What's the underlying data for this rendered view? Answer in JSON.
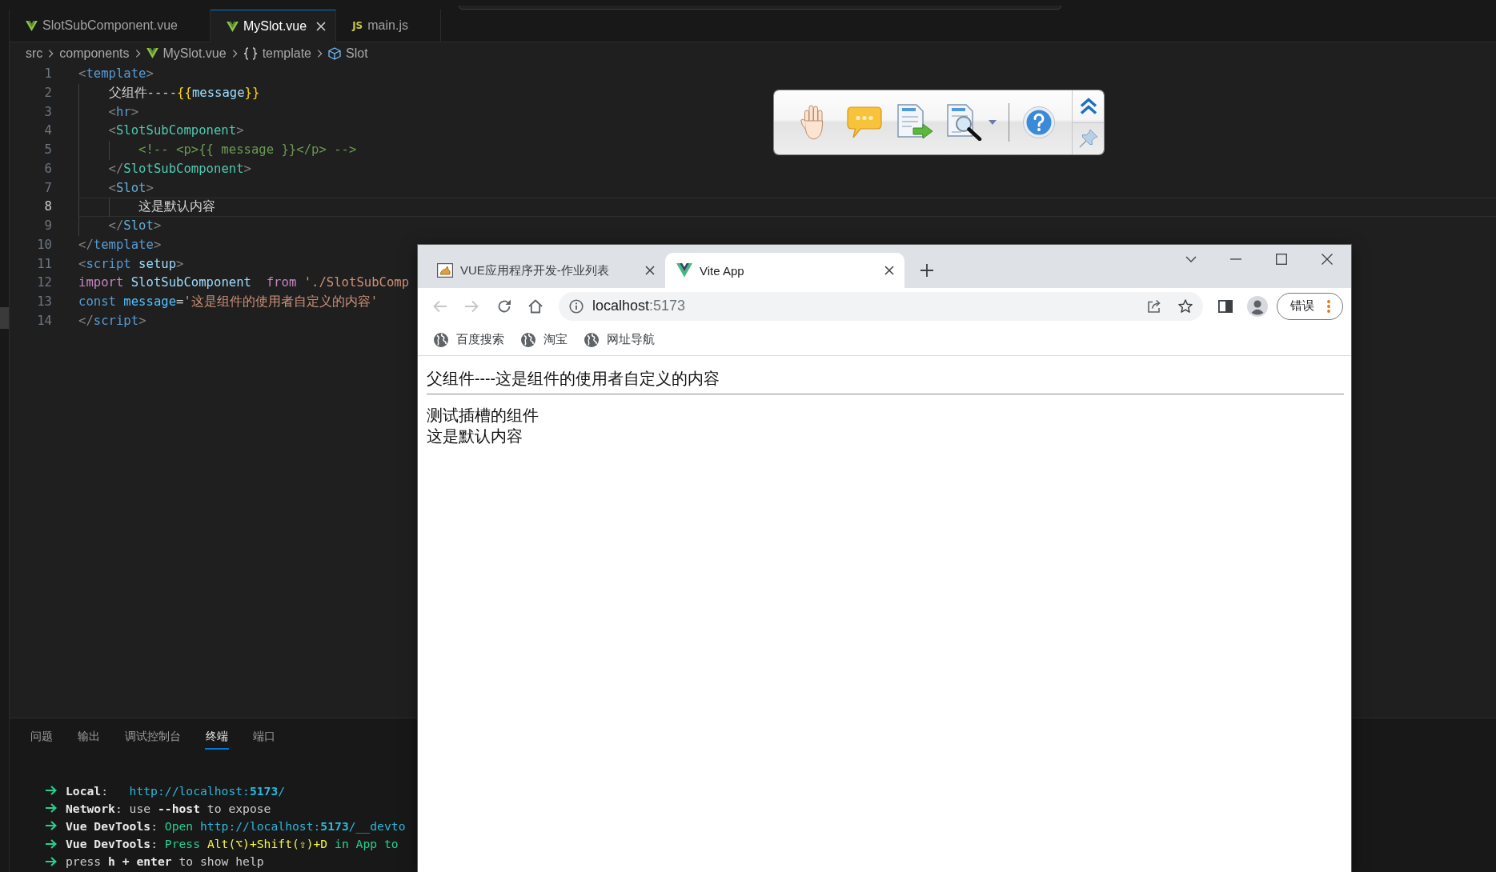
{
  "editor": {
    "tabs": [
      {
        "label": "SlotSubComponent.vue",
        "kind": "vue",
        "selected": false
      },
      {
        "label": "MySlot.vue",
        "kind": "vue",
        "selected": true
      },
      {
        "label": "main.js",
        "kind": "js",
        "badge": "JS",
        "selected": false
      }
    ],
    "breadcrumb": [
      {
        "label": "src",
        "kind": "folder"
      },
      {
        "label": "components",
        "kind": "folder"
      },
      {
        "label": "MySlot.vue",
        "kind": "vue"
      },
      {
        "label": "template",
        "kind": "braces"
      },
      {
        "label": "Slot",
        "kind": "cube"
      }
    ],
    "lines": [
      {
        "number": "1",
        "current": false,
        "tokens": [
          {
            "kind": "bracket",
            "text": "<"
          },
          {
            "kind": "tag",
            "text": "template"
          },
          {
            "kind": "bracket",
            "text": ">"
          }
        ],
        "children": [
          {
            "number": "2",
            "current": false,
            "tokens": [
              {
                "kind": "plain",
                "text": "父组件----"
              },
              {
                "kind": "interp",
                "text": "{{"
              },
              {
                "kind": "variable",
                "text": "message"
              },
              {
                "kind": "interp",
                "text": "}}"
              }
            ]
          },
          {
            "number": "3",
            "current": false,
            "tokens": [
              {
                "kind": "bracket",
                "text": "<"
              },
              {
                "kind": "tag",
                "text": "hr"
              },
              {
                "kind": "bracket",
                "text": ">"
              }
            ]
          },
          {
            "number": "4",
            "current": false,
            "tokens": [
              {
                "kind": "bracket",
                "text": "<"
              },
              {
                "kind": "component",
                "text": "SlotSubComponent"
              },
              {
                "kind": "bracket",
                "text": ">"
              }
            ],
            "children": [
              {
                "number": "5",
                "current": false,
                "tokens": [
                  {
                    "kind": "comment",
                    "text": "<!-- <p>{{ message }}</p> -->"
                  }
                ]
              }
            ]
          },
          {
            "number": "6",
            "current": false,
            "tokens": [
              {
                "kind": "bracket",
                "text": "</"
              },
              {
                "kind": "component",
                "text": "SlotSubComponent"
              },
              {
                "kind": "bracket",
                "text": ">"
              }
            ]
          },
          {
            "number": "7",
            "current": false,
            "tokens": [
              {
                "kind": "bracket",
                "text": "<"
              },
              {
                "kind": "slot",
                "text": "Slot"
              },
              {
                "kind": "bracket",
                "text": ">"
              }
            ],
            "children": [
              {
                "number": "8",
                "current": true,
                "tokens": [
                  {
                    "kind": "plain",
                    "text": "这是默认内容"
                  }
                ]
              }
            ]
          },
          {
            "number": "9",
            "current": false,
            "tokens": [
              {
                "kind": "bracket",
                "text": "</"
              },
              {
                "kind": "slot",
                "text": "Slot"
              },
              {
                "kind": "bracket",
                "text": ">"
              }
            ]
          }
        ]
      },
      {
        "number": "10",
        "current": false,
        "tokens": [
          {
            "kind": "bracket",
            "text": "</"
          },
          {
            "kind": "tag",
            "text": "template"
          },
          {
            "kind": "bracket",
            "text": ">"
          }
        ]
      },
      {
        "number": "11",
        "current": false,
        "tokens": [
          {
            "kind": "bracket",
            "text": "<"
          },
          {
            "kind": "tag",
            "text": "script"
          },
          {
            "kind": "attr",
            "text": " setup"
          },
          {
            "kind": "bracket",
            "text": ">"
          }
        ]
      },
      {
        "number": "12",
        "current": false,
        "tokens": [
          {
            "kind": "keyword",
            "text": "import "
          },
          {
            "kind": "variable",
            "text": "SlotSubComponent  "
          },
          {
            "kind": "keyword",
            "text": "from "
          },
          {
            "kind": "string",
            "text": "'./SlotSubComp"
          }
        ]
      },
      {
        "number": "13",
        "current": false,
        "tokens": [
          {
            "kind": "storage",
            "text": "const "
          },
          {
            "kind": "constant",
            "text": "message"
          },
          {
            "kind": "plain",
            "text": "="
          },
          {
            "kind": "string",
            "text": "'这是组件的使用者自定义的内容'"
          }
        ]
      },
      {
        "number": "14",
        "current": false,
        "tokens": [
          {
            "kind": "bracket",
            "text": "</"
          },
          {
            "kind": "tag",
            "text": "script"
          },
          {
            "kind": "bracket",
            "text": ">"
          }
        ]
      }
    ]
  },
  "panel": {
    "tabs": [
      {
        "label": "问题",
        "selected": false
      },
      {
        "label": "输出",
        "selected": false
      },
      {
        "label": "调试控制台",
        "selected": false
      },
      {
        "label": "终端",
        "selected": true
      },
      {
        "label": "端口",
        "selected": false
      }
    ],
    "terminal": [
      {
        "segments": [
          {
            "kind": "bold",
            "text": "Local"
          },
          {
            "kind": "plain",
            "text": ":   "
          },
          {
            "kind": "link",
            "text": "http://localhost:"
          },
          {
            "kind": "link-bold",
            "text": "5173"
          },
          {
            "kind": "link",
            "text": "/"
          }
        ]
      },
      {
        "segments": [
          {
            "kind": "bold",
            "text": "Network"
          },
          {
            "kind": "plain",
            "text": ": use "
          },
          {
            "kind": "bold",
            "text": "--host"
          },
          {
            "kind": "plain",
            "text": " to expose"
          }
        ]
      },
      {
        "segments": [
          {
            "kind": "bold",
            "text": "Vue DevTools"
          },
          {
            "kind": "plain",
            "text": ": "
          },
          {
            "kind": "green",
            "text": "Open "
          },
          {
            "kind": "link",
            "text": "http://localhost:"
          },
          {
            "kind": "link-bold",
            "text": "5173"
          },
          {
            "kind": "link",
            "text": "/__devto"
          }
        ]
      },
      {
        "segments": [
          {
            "kind": "bold",
            "text": "Vue DevTools"
          },
          {
            "kind": "plain",
            "text": ": "
          },
          {
            "kind": "green",
            "text": "Press "
          },
          {
            "kind": "yellow",
            "text": "Alt(⌥)+Shift(⇧)+D"
          },
          {
            "kind": "green",
            "text": " in App to"
          }
        ]
      },
      {
        "segments": [
          {
            "kind": "plain",
            "text": "press "
          },
          {
            "kind": "bold",
            "text": "h + enter"
          },
          {
            "kind": "plain",
            "text": " to show help"
          }
        ]
      }
    ]
  },
  "browser": {
    "tabs": [
      {
        "title": "VUE应用程序开发-作业列表",
        "kind": "picture",
        "selected": false
      },
      {
        "title": "Vite App",
        "kind": "vue",
        "selected": true
      }
    ],
    "back": {
      "disabled": true
    },
    "forward": {
      "disabled": true
    },
    "address": {
      "host": "localhost",
      "port": ":5173"
    },
    "profile_button": {
      "label": "错误"
    },
    "bookmarks": [
      {
        "label": "百度搜索"
      },
      {
        "label": "淘宝"
      },
      {
        "label": "网址导航"
      }
    ],
    "page": {
      "blocks": [
        {
          "kind": "text",
          "text": "父组件----这是组件的使用者自定义的内容"
        },
        {
          "kind": "rule"
        },
        {
          "kind": "text",
          "text": "测试插槽的组件"
        },
        {
          "kind": "text",
          "text": "这是默认内容"
        }
      ]
    }
  }
}
